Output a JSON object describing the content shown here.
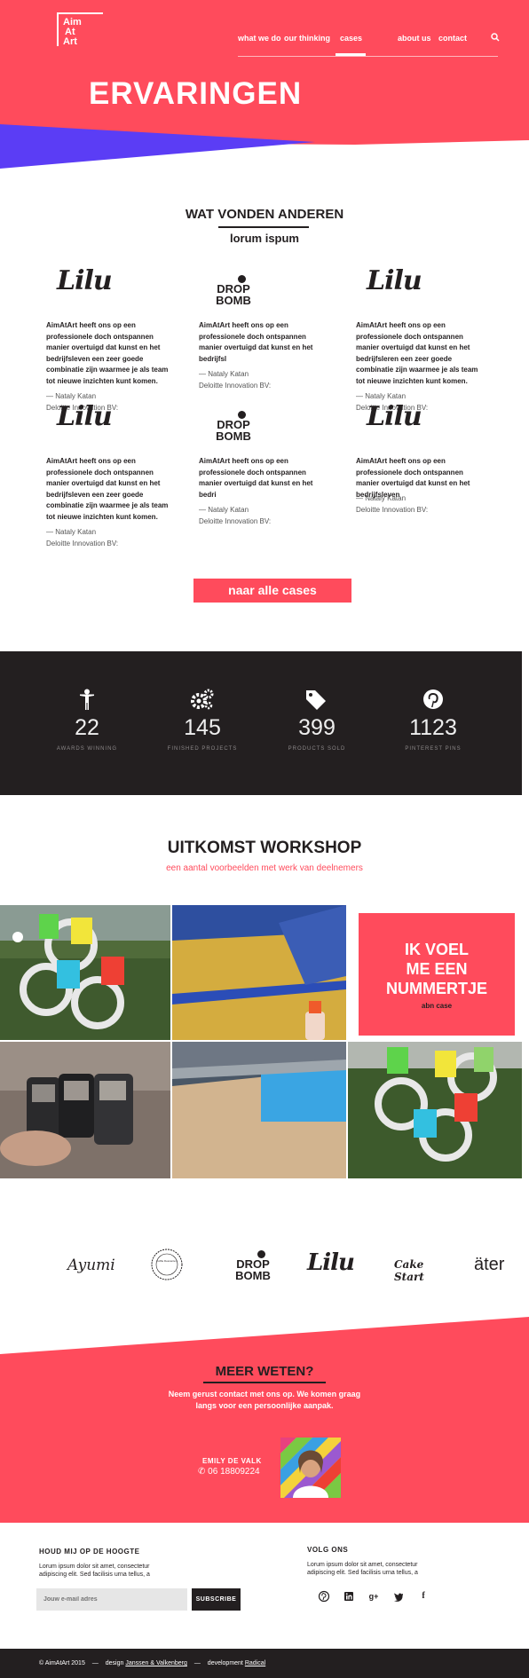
{
  "header": {
    "logo": [
      "Aim",
      "At",
      "Art"
    ],
    "nav": [
      "what we do",
      "our thinking",
      "cases",
      "about us",
      "contact"
    ],
    "active_nav": "cases",
    "title": "ERVARINGEN"
  },
  "testimonials": {
    "title": "WAT VONDEN ANDEREN",
    "subtitle": "lorum ispum",
    "items": [
      {
        "brand": "Lilu",
        "quote": "AimAtArt heeft ons op een professionele doch ontspannen manier overtuigd dat kunst en het bedrijfsleven een zeer goede combinatie zijn waarmee je als team tot nieuwe inzichten kunt komen.",
        "author": "— Nataly Katan",
        "company": "Deloitte Innovation BV:"
      },
      {
        "brand": "DROP BOMB",
        "quote": "AimAtArt heeft ons op een professionele doch ontspannen manier overtuigd dat kunst en het bedrijfsl",
        "author": "— Nataly Katan",
        "company": "Deloitte Innovation BV:"
      },
      {
        "brand": "Lilu",
        "quote": "AimAtArt heeft ons op een professionele doch ontspannen manier overtuigd dat kunst en het bedrijfsleren een zeer goede combinatie zijn waarmee je als team tot nieuwe inzichten kunt komen.",
        "author": "— Nataly Katan",
        "company": "Deloitte Innovation BV:"
      },
      {
        "brand": "Lilu",
        "quote": "AimAtArt heeft ons op een professionele doch ontspannen manier overtuigd dat kunst en het bedrijfsleven een zeer goede combinatie zijn waarmee je als team tot nieuwe inzichten kunt komen.",
        "author": "— Nataly Katan",
        "company": "Deloitte Innovation BV:"
      },
      {
        "brand": "DROP BOMB",
        "quote": "AimAtArt heeft ons op een professionele doch ontspannen manier overtuigd dat kunst en het bedri",
        "author": "— Nataly Katan",
        "company": "Deloitte Innovation BV:"
      },
      {
        "brand": "Lilu",
        "quote": "AimAtArt heeft ons op een professionele doch ontspannen manier overtuigd dat kunst en het bedrijfsleven",
        "author": "— Nataly Katan",
        "company": "Deloitte Innovation BV:"
      }
    ],
    "cta": "naar alle cases"
  },
  "stats": [
    {
      "icon": "person-icon",
      "value": "22",
      "label": "AWARDS WINNING"
    },
    {
      "icon": "gears-icon",
      "value": "145",
      "label": "FINISHED PROJECTS"
    },
    {
      "icon": "tags-icon",
      "value": "399",
      "label": "PRODUCTS SOLD"
    },
    {
      "icon": "pinterest-icon",
      "value": "1123",
      "label": "PINTEREST PINS"
    }
  ],
  "workshop": {
    "title": "UITKOMST WORKSHOP",
    "subtitle": "een aantal voorbeelden met werk van deelnemers",
    "promo_title": [
      "IK VOEL",
      "ME EEN",
      "NUMMERTJE"
    ],
    "promo_sub": "abn case"
  },
  "brands": [
    "Ayumi",
    "Koffie Descenten",
    "DROP BOMB",
    "Lilu",
    "Cake Start",
    "äter"
  ],
  "contact": {
    "title": "MEER WETEN?",
    "text_lines": [
      "Neem gerust contact met ons op. We komen graag",
      "langs voor een persoonlijke aanpak."
    ],
    "name": "EMILY DE VALK",
    "phone": "06 18809224"
  },
  "footer": {
    "newsletter_title": "HOUD MIJ OP DE HOOGTE",
    "newsletter_text": [
      "Lorum ipsum dolor sit amet, consectetur",
      "adipiscing elit. Sed facilisis urna tellus, a"
    ],
    "email_placeholder": "Jouw e-mail adres",
    "subscribe": "SUBSCRIBE",
    "follow_title": "VOLG ONS",
    "follow_text": [
      "Lorum ipsum dolor sit amet, consectetur",
      "adipiscing elit. Sed facilisis urna tellus, a"
    ],
    "social": [
      "pinterest-icon",
      "linkedin-icon",
      "googleplus-icon",
      "twitter-icon",
      "facebook-icon"
    ],
    "copyright": "© AimAtArt 2015",
    "design_label": "design",
    "design_by": "Janssen & Valkenberg",
    "dev_label": "development",
    "dev_by": "Radical"
  },
  "colors": {
    "accent": "#ff4b5c",
    "purple": "#5b3df5",
    "dark": "#231f20"
  }
}
